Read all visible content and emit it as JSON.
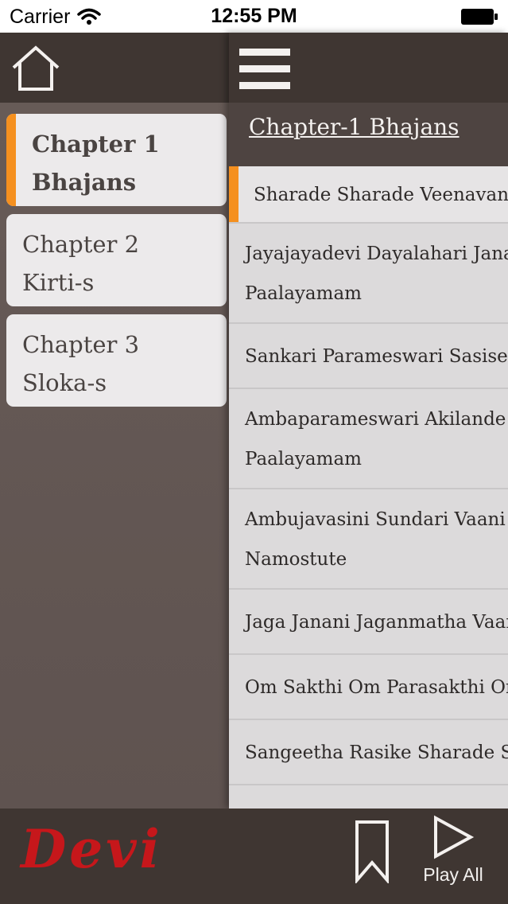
{
  "status_bar": {
    "carrier": "Carrier",
    "time": "12:55 PM",
    "wifi_icon": "wifi-icon",
    "battery_icon": "battery-icon"
  },
  "drawer": {
    "home_icon": "home-icon",
    "chapters": [
      {
        "line1": "Chapter 1",
        "line2": "Bhajans",
        "active": true
      },
      {
        "line1": "Chapter 2",
        "line2": "Kirti-s",
        "active": false
      },
      {
        "line1": "Chapter 3",
        "line2": "Sloka-s",
        "active": false
      }
    ]
  },
  "content": {
    "menu_icon": "hamburger-menu-icon",
    "title": "Chapter-1 Bhajans",
    "songs": [
      {
        "line1": "Sharade Sharade Veenavani",
        "line2": ""
      },
      {
        "line1": "Jayajayadevi Dayalahari Jana",
        "line2": "Paalayamam"
      },
      {
        "line1": "Sankari Parameswari Sasisek",
        "line2": ""
      },
      {
        "line1": "Ambaparameswari Akilande",
        "line2": "Paalayamam"
      },
      {
        "line1": "Ambujavasini Sundari Vaani",
        "line2": "Namostute"
      },
      {
        "line1": "Jaga Janani Jaganmatha Vaar",
        "line2": ""
      },
      {
        "line1": "Om Sakthi Om Parasakthi Or",
        "line2": ""
      },
      {
        "line1": "Sangeetha Rasike Sharade Sa",
        "line2": ""
      }
    ]
  },
  "bottom_bar": {
    "logo": "Devi",
    "bookmark_icon": "bookmark-icon",
    "play_icon": "play-icon",
    "play_all_label": "Play All"
  },
  "colors": {
    "accent": "#f5901f",
    "logo": "#c6171b",
    "bar_dark": "#3f3632"
  }
}
